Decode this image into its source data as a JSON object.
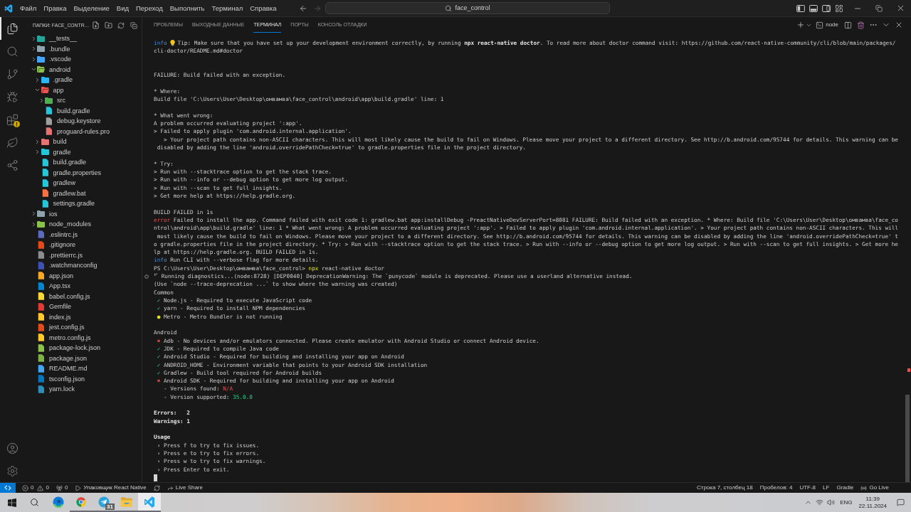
{
  "title_bar": {
    "menu": [
      "Файл",
      "Правка",
      "Выделение",
      "Вид",
      "Переход",
      "Выполнить",
      "Терминал",
      "Справка"
    ],
    "nav": [
      {
        "kind": "back",
        "disabled": false
      },
      {
        "kind": "forward",
        "disabled": true
      }
    ],
    "command_center": {
      "label": "face_control"
    },
    "layout_toggles": [
      {
        "kind": "primary-sidebar",
        "on": true
      },
      {
        "kind": "panel",
        "on": true
      },
      {
        "kind": "secondary-sidebar",
        "on": false
      }
    ]
  },
  "activity_bar": {
    "items": [
      {
        "kind": "explorer",
        "selected": true,
        "alert": false
      },
      {
        "kind": "search",
        "selected": false,
        "alert": false
      },
      {
        "kind": "source-control",
        "selected": false,
        "alert": false
      },
      {
        "kind": "run-debug",
        "selected": false,
        "alert": false
      },
      {
        "kind": "extensions",
        "selected": false,
        "alert": true
      },
      {
        "kind": "leaf",
        "selected": false,
        "alert": false
      },
      {
        "kind": "share",
        "selected": false,
        "alert": false
      }
    ],
    "bottom_items": [
      {
        "kind": "accounts"
      },
      {
        "kind": "manage"
      }
    ]
  },
  "sidebar": {
    "title": "ПАПКИ: FACE_CONTR…",
    "tree": [
      {
        "name": "__tests__",
        "kind": "folder",
        "expanded": false,
        "color": "#26a69a"
      },
      {
        "name": ".bundle",
        "kind": "folder",
        "expanded": false,
        "color": "#90a4ae"
      },
      {
        "name": ".vscode",
        "kind": "folder",
        "expanded": false,
        "color": "#42a5f5"
      },
      {
        "name": "android",
        "kind": "folder",
        "expanded": true,
        "color": "#8bc34a",
        "children": [
          {
            "name": ".gradle",
            "kind": "folder",
            "expanded": false,
            "color": "#29b6f6"
          },
          {
            "name": "app",
            "kind": "folder",
            "expanded": true,
            "color": "#ef5350",
            "children": [
              {
                "name": "src",
                "kind": "folder",
                "expanded": false,
                "color": "#4caf50"
              },
              {
                "name": "build.gradle",
                "kind": "file",
                "color": "#26c6da"
              },
              {
                "name": "debug.keystore",
                "kind": "file",
                "color": "#9e9e9e"
              },
              {
                "name": "proguard-rules.pro",
                "kind": "file",
                "color": "#e57373"
              }
            ]
          },
          {
            "name": "build",
            "kind": "folder",
            "expanded": false,
            "color": "#e57373"
          },
          {
            "name": "gradle",
            "kind": "folder",
            "expanded": false,
            "color": "#26c6da"
          },
          {
            "name": "build.gradle",
            "kind": "file",
            "color": "#26c6da"
          },
          {
            "name": "gradle.properties",
            "kind": "file",
            "color": "#26c6da"
          },
          {
            "name": "gradlew",
            "kind": "file",
            "color": "#26c6da"
          },
          {
            "name": "gradlew.bat",
            "kind": "file",
            "color": "#ff7043"
          },
          {
            "name": "settings.gradle",
            "kind": "file",
            "color": "#26c6da"
          }
        ]
      },
      {
        "name": "ios",
        "kind": "folder",
        "expanded": false,
        "color": "#90a4ae"
      },
      {
        "name": "node_modules",
        "kind": "folder",
        "expanded": false,
        "color": "#8bc34a"
      },
      {
        "name": ".eslintrc.js",
        "kind": "file",
        "color": "#5c6bc0"
      },
      {
        "name": ".gitignore",
        "kind": "file",
        "color": "#e64a19"
      },
      {
        "name": ".prettierrc.js",
        "kind": "file",
        "color": "#8d8d8d"
      },
      {
        "name": ".watchmanconfig",
        "kind": "file",
        "color": "#3f51b5"
      },
      {
        "name": "app.json",
        "kind": "file",
        "color": "#f9a825"
      },
      {
        "name": "App.tsx",
        "kind": "file",
        "color": "#0288d1"
      },
      {
        "name": "babel.config.js",
        "kind": "file",
        "color": "#fdd835"
      },
      {
        "name": "Gemfile",
        "kind": "file",
        "color": "#e53935"
      },
      {
        "name": "index.js",
        "kind": "file",
        "color": "#ffca28"
      },
      {
        "name": "jest.config.js",
        "kind": "file",
        "color": "#e64a19"
      },
      {
        "name": "metro.config.js",
        "kind": "file",
        "color": "#ffca28"
      },
      {
        "name": "package-lock.json",
        "kind": "file",
        "color": "#8bc34a"
      },
      {
        "name": "package.json",
        "kind": "file",
        "color": "#7cb342"
      },
      {
        "name": "README.md",
        "kind": "file",
        "color": "#42a5f5"
      },
      {
        "name": "tsconfig.json",
        "kind": "file",
        "color": "#0277bd"
      },
      {
        "name": "yarn.lock",
        "kind": "file",
        "color": "#2c8ebb"
      }
    ]
  },
  "panel": {
    "tabs": [
      {
        "label": "ПРОБЛЕМЫ",
        "selected": false
      },
      {
        "label": "ВЫХОДНЫЕ ДАННЫЕ",
        "selected": false
      },
      {
        "label": "ТЕРМИНАЛ",
        "selected": true
      },
      {
        "label": "ПОРТЫ",
        "selected": false
      },
      {
        "label": "КОНСОЛЬ ОТЛАДКИ",
        "selected": false
      }
    ],
    "terminal_name": "node",
    "terminal": {
      "lines": [
        {
          "kind": "tip",
          "label": "info",
          "text": "Tip: Make sure that you have set up your development environment correctly, by running **npx react-native doctor**. To read more about doctor command visit: https://github.com/react-native-community/cli/blob/main/packages/"
        },
        {
          "kind": "text",
          "segments": [
            {
              "kind": "plain",
              "text": "cli-doctor/README.md#doctor"
            }
          ]
        },
        {
          "kind": "blank"
        },
        {
          "kind": "blank"
        },
        {
          "kind": "text",
          "segments": [
            {
              "kind": "plain",
              "text": "FAILURE: Build failed with an exception."
            }
          ]
        },
        {
          "kind": "blank"
        },
        {
          "kind": "text",
          "segments": [
            {
              "kind": "plain",
              "text": "* Where:"
            }
          ]
        },
        {
          "kind": "text",
          "segments": [
            {
              "kind": "plain",
              "text": "Build file 'C:\\Users\\User\\Desktop\\омвамва\\face_control\\android\\app\\build.gradle' line: 1"
            }
          ]
        },
        {
          "kind": "blank"
        },
        {
          "kind": "text",
          "segments": [
            {
              "kind": "plain",
              "text": "* What went wrong:"
            }
          ]
        },
        {
          "kind": "text",
          "segments": [
            {
              "kind": "plain",
              "text": "A problem occurred evaluating project ':app'."
            }
          ]
        },
        {
          "kind": "text",
          "segments": [
            {
              "kind": "plain",
              "text": "> Failed to apply plugin 'com.android.internal.application'."
            }
          ]
        },
        {
          "kind": "text",
          "segments": [
            {
              "kind": "plain",
              "text": "   > Your project path contains non-ASCII characters. This will most likely cause the build to fail on Windows. Please move your project to a different directory. See http://b.android.com/95744 for details. This warning can be"
            }
          ]
        },
        {
          "kind": "text",
          "segments": [
            {
              "kind": "plain",
              "text": " disabled by adding the line 'android.overridePathCheck=true' to gradle.properties file in the project directory."
            }
          ]
        },
        {
          "kind": "blank"
        },
        {
          "kind": "text",
          "segments": [
            {
              "kind": "plain",
              "text": "* Try:"
            }
          ]
        },
        {
          "kind": "text",
          "segments": [
            {
              "kind": "plain",
              "text": "> Run with --stacktrace option to get the stack trace."
            }
          ]
        },
        {
          "kind": "text",
          "segments": [
            {
              "kind": "plain",
              "text": "> Run with --info or --debug option to get more log output."
            }
          ]
        },
        {
          "kind": "text",
          "segments": [
            {
              "kind": "plain",
              "text": "> Run with --scan to get full insights."
            }
          ]
        },
        {
          "kind": "text",
          "segments": [
            {
              "kind": "plain",
              "text": "> Get more help at https://help.gradle.org."
            }
          ]
        },
        {
          "kind": "blank"
        },
        {
          "kind": "text",
          "segments": [
            {
              "kind": "plain",
              "text": "BUILD FAILED in 1s"
            }
          ]
        },
        {
          "kind": "text",
          "segments": [
            {
              "kind": "error",
              "text": "error"
            },
            {
              "kind": "plain",
              "text": " Failed to install the app. Command failed with exit code 1: gradlew.bat app:installDebug -PreactNativeDevServerPort=8081 FAILURE: Build failed with an exception. * Where: Build file 'C:\\Users\\User\\Desktop\\омвамва\\face_co"
            }
          ]
        },
        {
          "kind": "text",
          "segments": [
            {
              "kind": "plain",
              "text": "ntrol\\android\\app\\build.gradle' line: 1 * What went wrong: A problem occurred evaluating project ':app'. > Failed to apply plugin 'com.android.internal.application'. > Your project path contains non-ASCII characters. This will"
            }
          ]
        },
        {
          "kind": "text",
          "segments": [
            {
              "kind": "plain",
              "text": " most likely cause the build to fail on Windows. Please move your project to a different directory. See http://b.android.com/95744 for details. This warning can be disabled by adding the line 'android.overridePathCheck=true' t"
            }
          ]
        },
        {
          "kind": "text",
          "segments": [
            {
              "kind": "plain",
              "text": "o gradle.properties file in the project directory. * Try: > Run with --stacktrace option to get the stack trace. > Run with --info or --debug option to get more log output. > Run with --scan to get full insights. > Get more he"
            }
          ]
        },
        {
          "kind": "text",
          "segments": [
            {
              "kind": "plain",
              "text": "lp at https://help.gradle.org. BUILD FAILED in 1s."
            }
          ]
        },
        {
          "kind": "text",
          "segments": [
            {
              "kind": "info",
              "text": "info"
            },
            {
              "kind": "plain",
              "text": " Run CLI with --verbose flag for more details."
            }
          ]
        },
        {
          "kind": "text",
          "segments": [
            {
              "kind": "plain",
              "text": "PS C:\\Users\\User\\Desktop\\омвамва\\face_control> "
            },
            {
              "kind": "command",
              "text": "npx"
            },
            {
              "kind": "plain",
              "text": " react-native doctor"
            }
          ]
        },
        {
          "kind": "marked",
          "segments": [
            {
              "kind": "plain",
              "text": "⠋ Running diagnostics...(node:8728) [DEP0040] DeprecationWarning: The `punycode` module is deprecated. Please use a userland alternative instead."
            }
          ]
        },
        {
          "kind": "text",
          "segments": [
            {
              "kind": "plain",
              "text": "(Use `node --trace-deprecation ...` to show where the warning was created)"
            }
          ]
        },
        {
          "kind": "text",
          "segments": [
            {
              "kind": "plain",
              "text": "Common"
            }
          ]
        },
        {
          "kind": "text",
          "segments": [
            {
              "kind": "success",
              "text": " ✓"
            },
            {
              "kind": "plain",
              "text": " Node.js - Required to execute JavaScript code"
            }
          ]
        },
        {
          "kind": "text",
          "segments": [
            {
              "kind": "success",
              "text": " ✓"
            },
            {
              "kind": "plain",
              "text": " yarn - Required to install NPM dependencies"
            }
          ]
        },
        {
          "kind": "text",
          "segments": [
            {
              "kind": "warning",
              "text": " ●"
            },
            {
              "kind": "plain",
              "text": " Metro - Metro Bundler is not running"
            }
          ]
        },
        {
          "kind": "blank"
        },
        {
          "kind": "text",
          "segments": [
            {
              "kind": "plain",
              "text": "Android"
            }
          ]
        },
        {
          "kind": "text",
          "segments": [
            {
              "kind": "failure",
              "text": " ✖"
            },
            {
              "kind": "plain",
              "text": " Adb - No devices and/or emulators connected. Please create emulator with Android Studio or connect Android device."
            }
          ]
        },
        {
          "kind": "text",
          "segments": [
            {
              "kind": "success",
              "text": " ✓"
            },
            {
              "kind": "plain",
              "text": " JDK - Required to compile Java code"
            }
          ]
        },
        {
          "kind": "text",
          "segments": [
            {
              "kind": "success",
              "text": " ✓"
            },
            {
              "kind": "plain",
              "text": " Android Studio - Required for building and installing your app on Android"
            }
          ]
        },
        {
          "kind": "text",
          "segments": [
            {
              "kind": "success",
              "text": " ✓"
            },
            {
              "kind": "plain",
              "text": " ANDROID_HOME - Environment variable that points to your Android SDK installation"
            }
          ]
        },
        {
          "kind": "text",
          "segments": [
            {
              "kind": "success",
              "text": " ✓"
            },
            {
              "kind": "plain",
              "text": " Gradlew - Build tool required for Android builds"
            }
          ]
        },
        {
          "kind": "text",
          "segments": [
            {
              "kind": "failure",
              "text": " ✖"
            },
            {
              "kind": "plain",
              "text": " Android SDK - Required for building and installing your app on Android"
            }
          ]
        },
        {
          "kind": "text",
          "segments": [
            {
              "kind": "plain",
              "text": "   - Versions found: "
            },
            {
              "kind": "failure",
              "text": "N/A"
            }
          ]
        },
        {
          "kind": "text",
          "segments": [
            {
              "kind": "plain",
              "text": "   - Version supported: "
            },
            {
              "kind": "success",
              "text": "35.0.0"
            }
          ]
        },
        {
          "kind": "blank"
        },
        {
          "kind": "text",
          "segments": [
            {
              "kind": "bold",
              "text": "Errors:   2"
            }
          ]
        },
        {
          "kind": "text",
          "segments": [
            {
              "kind": "bold",
              "text": "Warnings: 1"
            }
          ]
        },
        {
          "kind": "blank"
        },
        {
          "kind": "text",
          "segments": [
            {
              "kind": "bold",
              "text": "Usage"
            }
          ]
        },
        {
          "kind": "text",
          "segments": [
            {
              "kind": "plain",
              "text": " › Press f to try to fix issues."
            }
          ]
        },
        {
          "kind": "text",
          "segments": [
            {
              "kind": "plain",
              "text": " › Press e to try to fix errors."
            }
          ]
        },
        {
          "kind": "text",
          "segments": [
            {
              "kind": "plain",
              "text": " › Press w to try to fix warnings."
            }
          ]
        },
        {
          "kind": "text",
          "segments": [
            {
              "kind": "plain",
              "text": " › Press Enter to exit."
            }
          ]
        },
        {
          "kind": "cursor"
        }
      ]
    }
  },
  "status_bar": {
    "left": [
      {
        "kind": "remote"
      },
      {
        "kind": "problems",
        "errors": "0",
        "warnings": "0"
      },
      {
        "kind": "ports",
        "text": "0"
      },
      {
        "kind": "run",
        "text": "Упаковщик React Native"
      },
      {
        "kind": "sync"
      },
      {
        "kind": "live-share",
        "text": "Live Share"
      }
    ],
    "right": [
      {
        "kind": "plain",
        "text": "Строка 7, столбец 18"
      },
      {
        "kind": "plain",
        "text": "Пробелов: 4"
      },
      {
        "kind": "plain",
        "text": "UTF-8"
      },
      {
        "kind": "plain",
        "text": "LF"
      },
      {
        "kind": "plain",
        "text": "Gradle"
      },
      {
        "kind": "go-live",
        "text": "Go Live"
      }
    ]
  },
  "taskbar": {
    "apps": [
      {
        "kind": "edge",
        "selected": false,
        "running": false
      },
      {
        "kind": "chrome",
        "selected": false,
        "running": true
      },
      {
        "kind": "telegram",
        "selected": false,
        "running": true,
        "count": "31"
      },
      {
        "kind": "file-explorer",
        "selected": false,
        "running": true
      },
      {
        "kind": "vscode",
        "selected": true,
        "running": true
      }
    ],
    "tray": {
      "language": "ENG",
      "time": "11:39",
      "date": "22.11.2024"
    }
  }
}
